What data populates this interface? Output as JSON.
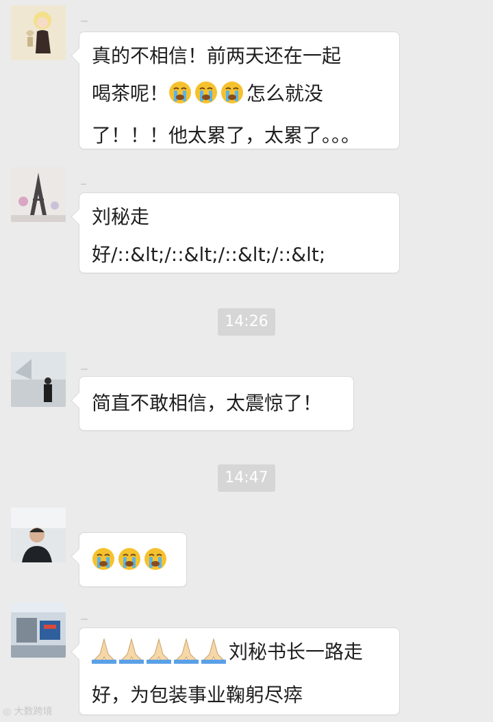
{
  "messages": [
    {
      "lines": [
        "真的不相信！前两天还在一起",
        "喝茶呢！",
        "了！！！他太累了，太累了。。。"
      ],
      "after_emoji_text": "怎么就没",
      "emoji_icons": [
        "crying-face-icon",
        "crying-face-icon",
        "crying-face-icon"
      ]
    },
    {
      "lines": [
        "刘秘走",
        "好/::&lt;/::&lt;/::&lt;/::&lt;"
      ]
    },
    {
      "lines": [
        "简直不敢相信，太震惊了！"
      ]
    },
    {
      "emoji_icons": [
        "crying-face-icon",
        "crying-face-icon",
        "crying-face-icon"
      ]
    },
    {
      "lines": [
        "刘秘书长一路走",
        "好，为包装事业鞠躬尽瘁"
      ],
      "emoji_icons": [
        "folded-hands-icon",
        "folded-hands-icon",
        "folded-hands-icon",
        "folded-hands-icon",
        "folded-hands-icon"
      ]
    }
  ],
  "timestamps": [
    "14:26",
    "14:47"
  ],
  "watermark": "大数跨境",
  "colors": {
    "background": "#ebebeb",
    "bubble": "#ffffff",
    "timestamp_bg": "#d6d6d6",
    "emoji_yellow": "#f6c12e"
  }
}
